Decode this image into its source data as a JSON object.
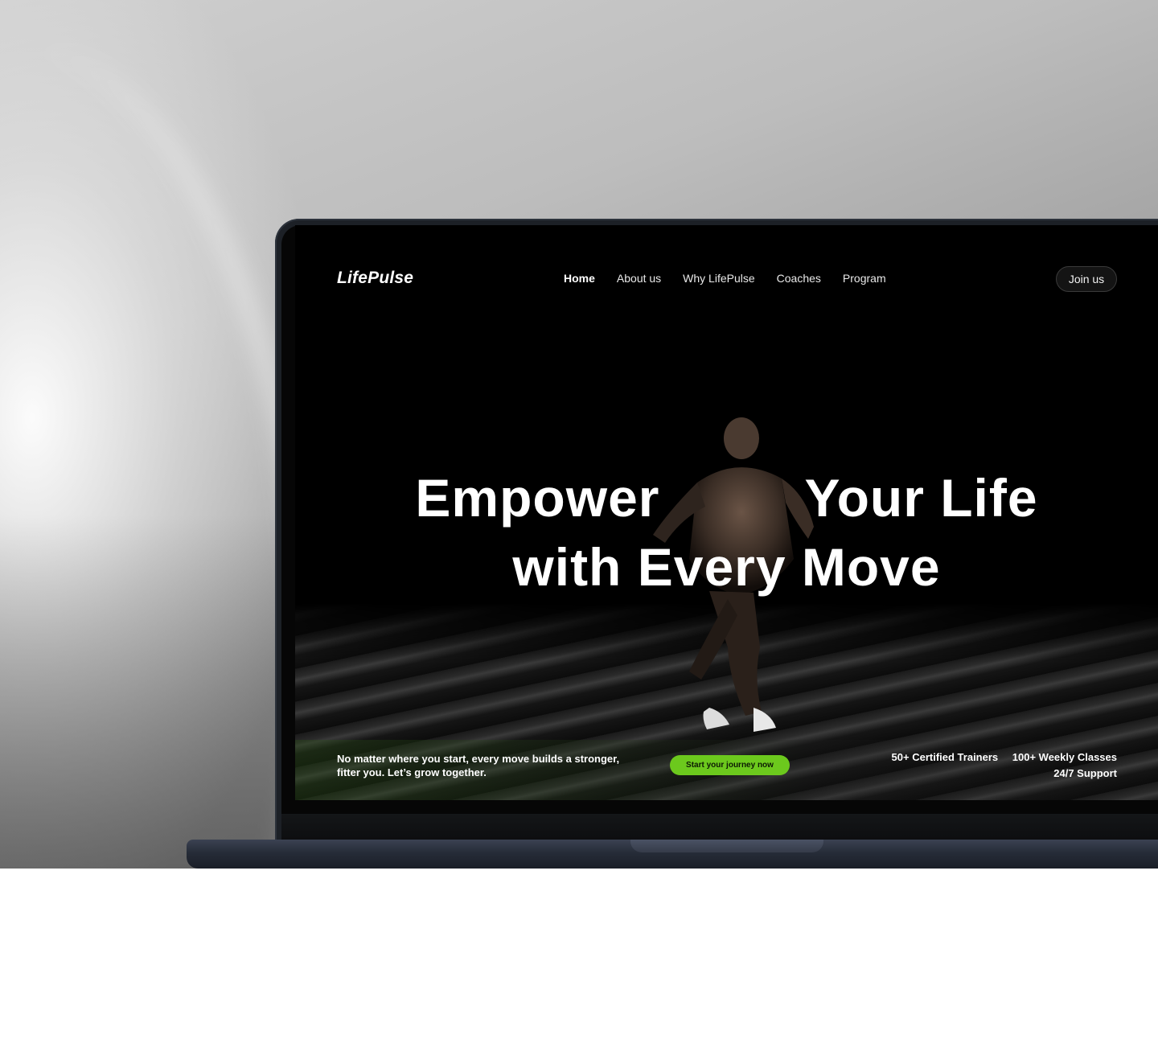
{
  "site": {
    "brand": "LifePulse",
    "nav": [
      {
        "label": "Home",
        "active": true
      },
      {
        "label": "About us",
        "active": false
      },
      {
        "label": "Why LifePulse",
        "active": false
      },
      {
        "label": "Coaches",
        "active": false
      },
      {
        "label": "Program",
        "active": false
      }
    ],
    "join_label": "Join us"
  },
  "hero": {
    "headline_line1_part1": "Empower",
    "headline_line1_part2": "Your Life",
    "headline_line2": "with Every Move",
    "tagline": "No matter where you start, every move builds a stronger, fitter you. Let’s grow together.",
    "cta_label": "Start your journey now",
    "stats": {
      "trainers": "50+ Certified Trainers",
      "classes": "100+ Weekly Classes",
      "support": "24/7 Support"
    }
  },
  "colors": {
    "accent": "#6cc91d",
    "screen_bg": "#000000",
    "laptop_body": "#1c2026"
  },
  "icons": {
    "camera": "webcam-dot"
  }
}
